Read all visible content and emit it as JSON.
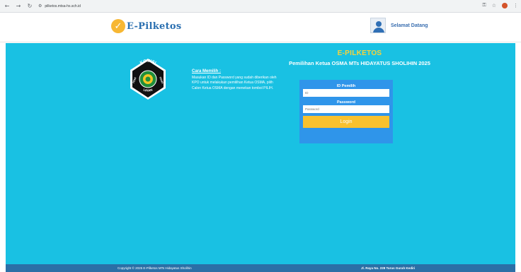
{
  "browser": {
    "url": "pilketos.mtsa-hs.sch.id",
    "back_icon": "arrow-left-icon",
    "forward_icon": "arrow-right-icon",
    "reload_icon": "reload-icon"
  },
  "header": {
    "logo_text": "E-Pilketos",
    "welcome": "Selamat Datang"
  },
  "main": {
    "howto_title": "Cara Memilih :",
    "howto_text": "Masukan ID dan Password yang sudah diberikan oleh KPO untuk melakukan pemilihan Ketua OSMA, pilih Calon Ketua OSMA dengan menekan tombol PILIH.",
    "emblem": {
      "top": "KOMISI",
      "left": "PEMI",
      "right": "OSMA",
      "bottom": "LIHAN"
    },
    "app_name": "E-PILKETOS",
    "election_title": "Pemilihan Ketua OSMA MTs HIDAYATUS SHOLIHIN 2025"
  },
  "login": {
    "id_label": "ID Pemilih",
    "id_placeholder": "ID",
    "password_label": "Password",
    "password_placeholder": "Password",
    "button": "Login"
  },
  "footer": {
    "copyright": "Copyright © 2025 E-Pilketos MTs Hidayatus Sholihin",
    "address": "Jl. Raya No. 228 Turus Gurah Kediri"
  },
  "colors": {
    "main_bg": "#19c1e3",
    "panel_bg": "#2f95ea",
    "button": "#f9c12e",
    "app_name": "#f7d23a",
    "footer": "#2b6fa6"
  }
}
